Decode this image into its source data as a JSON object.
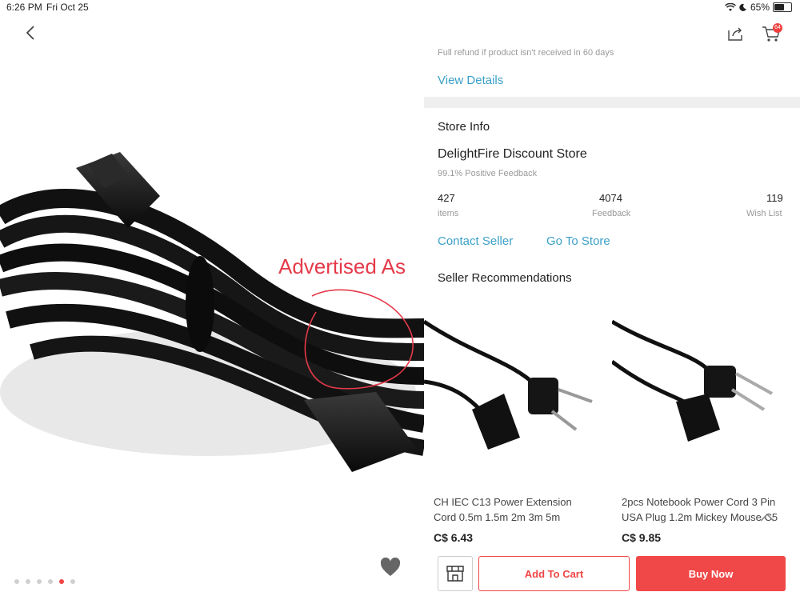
{
  "status_bar": {
    "time": "6:26 PM",
    "date": "Fri Oct 25",
    "battery": "65%",
    "battery_level": 0.65,
    "icons": [
      "wifi-icon",
      "moon-icon",
      "battery-icon"
    ]
  },
  "header": {
    "back_icon": "chevron-left-icon",
    "share_icon": "share-icon",
    "cart_icon": "cart-icon",
    "cart_count": "64"
  },
  "product_image": {
    "overlay_text": "Advertised As",
    "dots_total": 6,
    "active_dot": 4
  },
  "shipping": {
    "refund_note": "Full refund if product isn't received in 60 days",
    "view_details": "View Details"
  },
  "store": {
    "section_title": "Store Info",
    "name": "DelightFire Discount Store",
    "positive_feedback": "99.1% Positive Feedback",
    "stats": [
      {
        "value": "427",
        "label": "items"
      },
      {
        "value": "4074",
        "label": "Feedback"
      },
      {
        "value": "119",
        "label": "Wish List"
      }
    ],
    "contact_seller": "Contact Seller",
    "go_to_store": "Go To Store"
  },
  "recommendations": {
    "title": "Seller Recommendations",
    "items": [
      {
        "title_line1": "CH IEC C13 Power Extension",
        "title_line2": "Cord 0.5m 1.5m 2m 3m 5m",
        "price": "C$ 6.43"
      },
      {
        "title_line1": "2pcs Notebook Power Cord 3 Pin",
        "title_line2": "USA Plug 1.2m Mickey Mouse C5",
        "price": "C$ 9.85"
      }
    ]
  },
  "actions": {
    "add_to_cart": "Add To Cart",
    "buy_now": "Buy Now"
  },
  "colors": {
    "accent": "#f04545",
    "link": "#3ba0c8",
    "overlay_text": "#e53a4a"
  }
}
